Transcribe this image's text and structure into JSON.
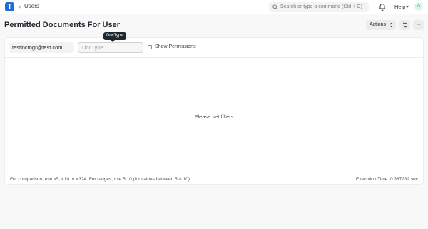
{
  "navbar": {
    "logo_letter": "T",
    "breadcrumb_sep": "›",
    "breadcrumb": "Users",
    "search_placeholder": "Search or type a command (Ctrl + G)",
    "help_label": "Help",
    "avatar_letter": "A"
  },
  "page": {
    "title": "Permitted Documents For User",
    "actions_label": "Actions",
    "more_label": "···"
  },
  "filters": {
    "user_value": "testincmgr@test.com",
    "doctype_placeholder": "DocType",
    "doctype_tooltip": "DocType",
    "show_permissions_label": "Show Permissions"
  },
  "report": {
    "empty_message": "Please set filters",
    "footer_hint": "For comparison, use >5, <10 or =324. For ranges, use 5:10 (for values between 5 & 10).",
    "execution_time": "Execution Time: 0.387232 sec"
  },
  "colors": {
    "brand": "#1f6fd1",
    "avatar_bg": "#dff5e6",
    "avatar_fg": "#30a66d"
  }
}
